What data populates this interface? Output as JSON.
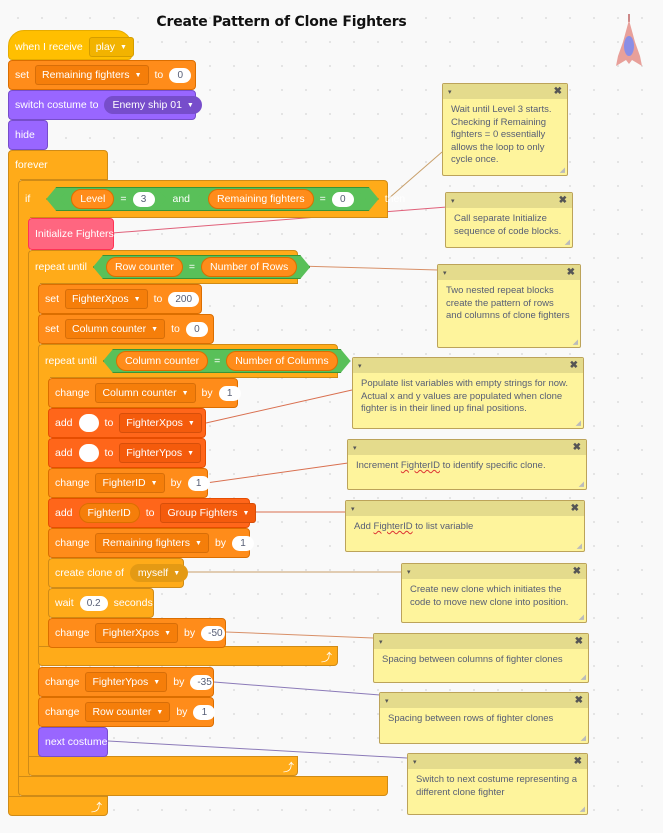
{
  "title": "Create Pattern of Clone Fighters",
  "sprite": {
    "icon": "enemy-ship-icon",
    "colors": {
      "body": "#e8a09a",
      "cockpit": "#8a8ee6"
    }
  },
  "colors": {
    "events": "#ffbf00",
    "variables": "#ff8c1a",
    "lists": "#ff661a",
    "looks": "#9966ff",
    "control": "#ffab19",
    "operators": "#59c059",
    "my_blocks": "#ff6680",
    "comment": "#fef49c"
  },
  "script": {
    "hat": {
      "label": "when I receive",
      "message": "play"
    },
    "set_remaining": {
      "op": "set",
      "var": "Remaining fighters",
      "to": "to",
      "value": "0"
    },
    "switch_costume": {
      "label": "switch costume to",
      "costume": "Enemy ship 01"
    },
    "hide": {
      "label": "hide"
    },
    "forever": {
      "label": "forever"
    },
    "if_block": {
      "if": "if",
      "then": "then",
      "and": "and",
      "left": {
        "var": "Level",
        "op": "=",
        "value": "3"
      },
      "right": {
        "var": "Remaining fighters",
        "op": "=",
        "value": "0"
      }
    },
    "init": {
      "label": "Initialize Fighters"
    },
    "repeat_rows": {
      "label": "repeat until",
      "left": "Row counter",
      "op": "=",
      "right": "Number of Rows"
    },
    "set_xpos": {
      "op": "set",
      "var": "FighterXpos",
      "to": "to",
      "value": "200"
    },
    "set_col": {
      "op": "set",
      "var": "Column counter",
      "to": "to",
      "value": "0"
    },
    "repeat_cols": {
      "label": "repeat until",
      "left": "Column counter",
      "op": "=",
      "right": "Number of Columns"
    },
    "change_col": {
      "op": "change",
      "var": "Column counter",
      "by": "by",
      "value": "1"
    },
    "add_x": {
      "op": "add",
      "value": "",
      "to": "to",
      "list": "FighterXpos"
    },
    "add_y": {
      "op": "add",
      "value": "",
      "to": "to",
      "list": "FighterYpos"
    },
    "change_id": {
      "op": "change",
      "var": "FighterID",
      "by": "by",
      "value": "1"
    },
    "add_id": {
      "op": "add",
      "value": "FighterID",
      "to": "to",
      "list": "Group Fighters"
    },
    "change_remaining": {
      "op": "change",
      "var": "Remaining fighters",
      "by": "by",
      "value": "1"
    },
    "clone": {
      "label": "create clone of",
      "target": "myself"
    },
    "wait": {
      "label": "wait",
      "value": "0.2",
      "unit": "seconds"
    },
    "change_xpos": {
      "op": "change",
      "var": "FighterXpos",
      "by": "by",
      "value": "-50"
    },
    "change_ypos": {
      "op": "change",
      "var": "FighterYpos",
      "by": "by",
      "value": "-35"
    },
    "change_row": {
      "op": "change",
      "var": "Row counter",
      "by": "by",
      "value": "1"
    },
    "next_costume": {
      "label": "next costume"
    }
  },
  "comments": [
    {
      "id": "c1",
      "text": "Wait until Level 3 starts. Checking if Remaining fighters = 0 essentially allows the loop to only cycle once."
    },
    {
      "id": "c2",
      "text": "Call separate Initialize sequence of code blocks."
    },
    {
      "id": "c3",
      "text": "Two nested repeat blocks create the pattern of rows and columns of clone fighters"
    },
    {
      "id": "c4",
      "text": "Populate list variables with empty strings for now. Actual x and y values are populated when clone fighter is in their lined up final positions."
    },
    {
      "id": "c5",
      "pre": "Increment ",
      "mark": "FighterID",
      "post": " to identify specific clone."
    },
    {
      "id": "c6",
      "pre": "Add ",
      "mark": "FighterID",
      "post": " to list variable"
    },
    {
      "id": "c7",
      "text": "Create new clone which initiates the code to move new clone into position."
    },
    {
      "id": "c8",
      "text": "Spacing between columns of fighter clones"
    },
    {
      "id": "c9",
      "text": "Spacing between rows of fighter clones"
    },
    {
      "id": "c10",
      "text": "Switch to next costume representing a different clone fighter"
    }
  ],
  "comment_controls": {
    "collapse": "▾",
    "close": "✖"
  }
}
